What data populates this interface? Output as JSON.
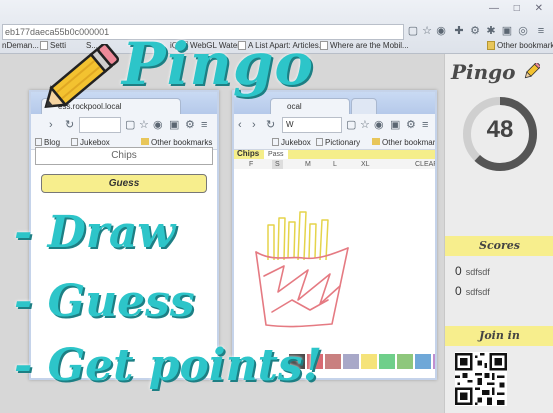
{
  "outer_browser": {
    "address": "eb177daeca55b0c000001",
    "bookmarks": [
      {
        "label": "nDeman..."
      },
      {
        "label": "Setti"
      },
      {
        "label": "S..."
      },
      {
        "label": "iQ"
      },
      {
        "label": "WebGL Water"
      },
      {
        "label": "A List Apart: Articles..."
      },
      {
        "label": "Where are the Mobil..."
      }
    ],
    "other_bookmarks": "Other bookmarks",
    "window_controls": "— □ ✕"
  },
  "promo": {
    "title": "Pingo",
    "lines": [
      "- Draw",
      "- Guess",
      "- Get points!"
    ]
  },
  "guesser_window": {
    "tab_title": "ess.rockpool.local",
    "bookmarks": [
      "Blog",
      "Jukebox"
    ],
    "other_bookmarks": "Other bookmarks",
    "input_placeholder": "Chips",
    "guess_label": "Guess"
  },
  "drawer_window": {
    "tab_title": "ocal",
    "address_fragment": "W",
    "bookmarks": [
      "Jukebox",
      "Pictionary"
    ],
    "other_bookmarks": "Other bookmarks",
    "word": "Chips",
    "pass_label": "Pass",
    "sizes": [
      "F",
      "S",
      "M",
      "L",
      "XL"
    ],
    "selected_size": "S",
    "clear_label": "CLEAR",
    "palette": [
      "#4a4a4a",
      "#d86a72",
      "#c98080",
      "#a8a8c8",
      "#f5e37a",
      "#6fcf8a",
      "#8ec77c",
      "#6fa8d8",
      "#c08fd0"
    ],
    "selected_color": "#f5e37a"
  },
  "pingo_panel": {
    "logo": "Pingo",
    "score": "48",
    "score_fraction": 0.62,
    "scores_heading": "Scores",
    "players": [
      {
        "points": "0",
        "name": "sdfsdf"
      },
      {
        "points": "0",
        "name": "sdfsdf"
      }
    ],
    "join_heading": "Join in"
  },
  "colors": {
    "promo_teal": "#2dc5c9",
    "band_yellow": "#f7ee8d",
    "ring_dark": "#555555"
  }
}
